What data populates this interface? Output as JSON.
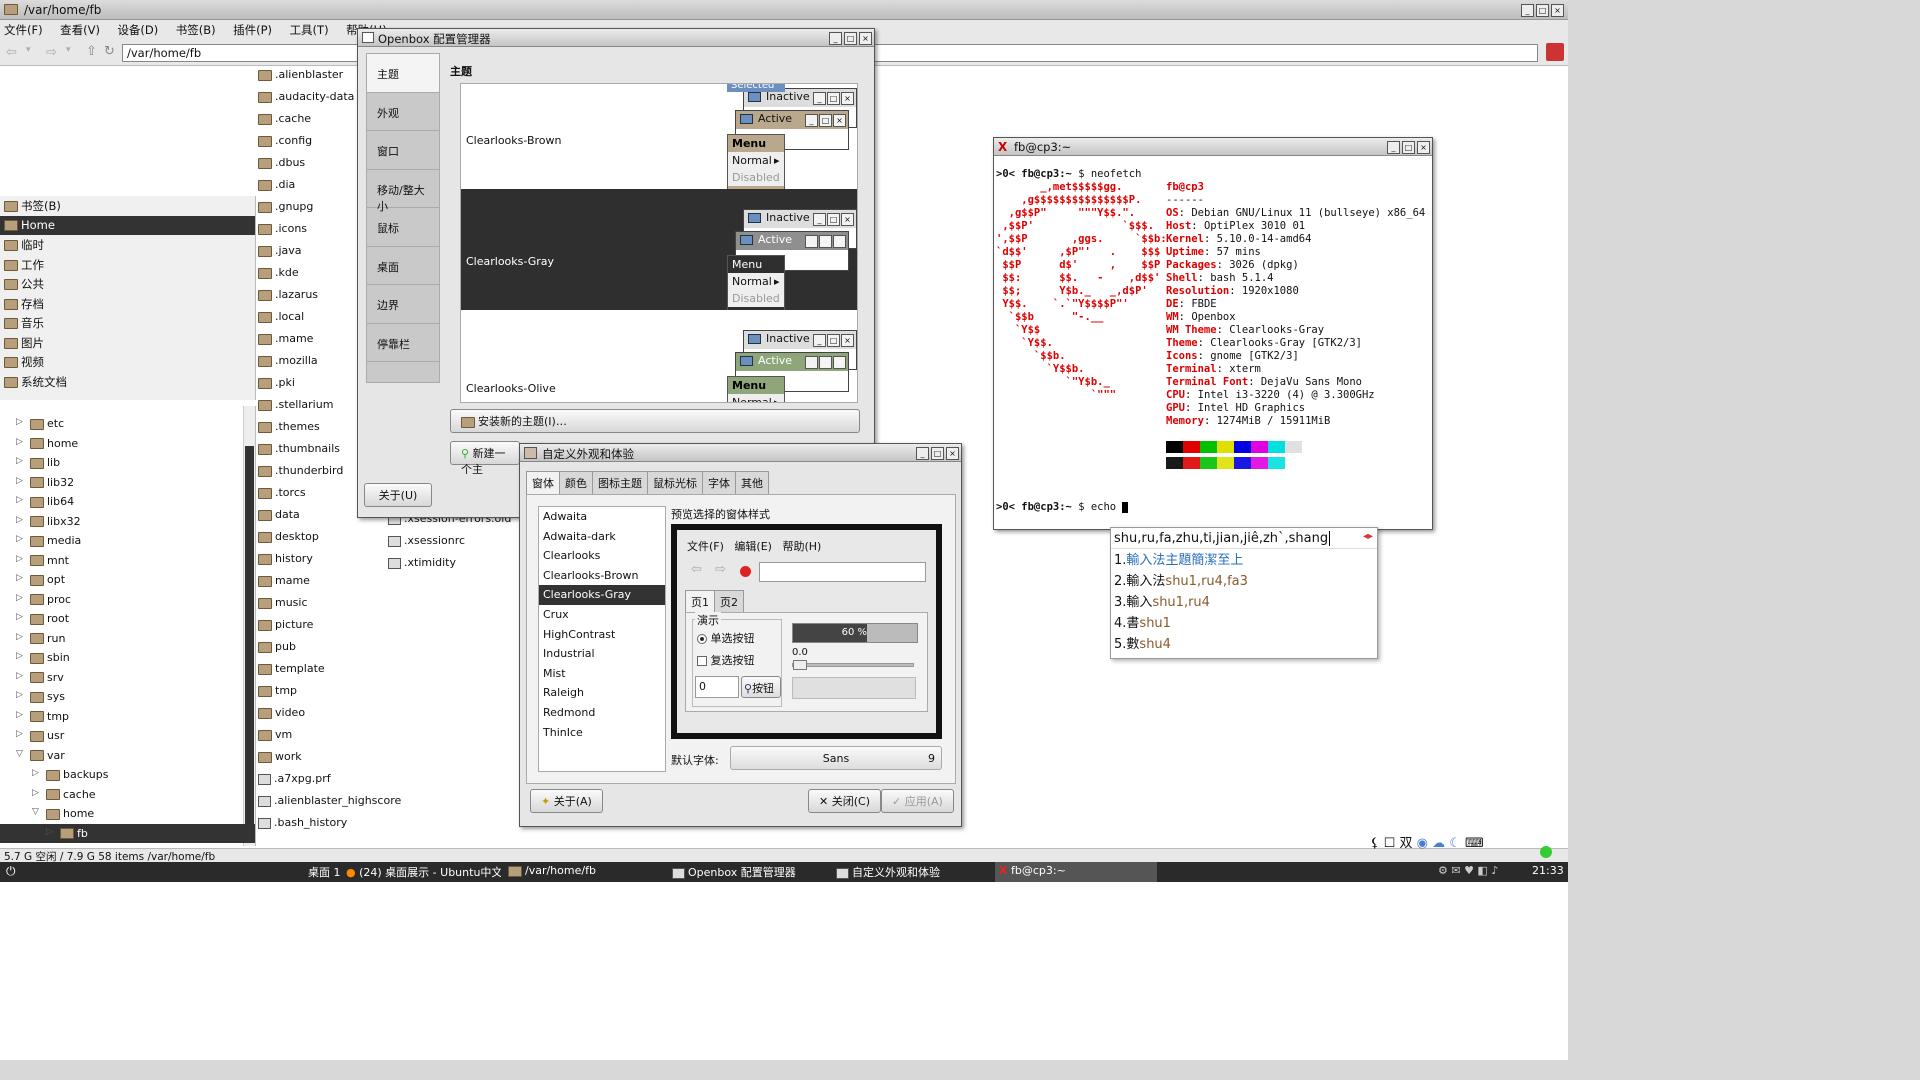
{
  "fm": {
    "title": "/var/home/fb",
    "menu": [
      "文件(F)",
      "查看(V)",
      "设备(D)",
      "书签(B)",
      "插件(P)",
      "工具(T)",
      "帮助(H)"
    ],
    "path": "/var/home/fb",
    "bookmarks": [
      "书签(B)",
      "Home",
      "临时",
      "工作",
      "公共",
      "存档",
      "音乐",
      "图片",
      "视频",
      "系统文档"
    ],
    "tree": [
      {
        "n": "etc",
        "l": 1
      },
      {
        "n": "home",
        "l": 1
      },
      {
        "n": "lib",
        "l": 1
      },
      {
        "n": "lib32",
        "l": 1
      },
      {
        "n": "lib64",
        "l": 1
      },
      {
        "n": "libx32",
        "l": 1
      },
      {
        "n": "media",
        "l": 1
      },
      {
        "n": "mnt",
        "l": 1
      },
      {
        "n": "opt",
        "l": 1
      },
      {
        "n": "proc",
        "l": 1
      },
      {
        "n": "root",
        "l": 1
      },
      {
        "n": "run",
        "l": 1
      },
      {
        "n": "sbin",
        "l": 1
      },
      {
        "n": "srv",
        "l": 1
      },
      {
        "n": "sys",
        "l": 1
      },
      {
        "n": "tmp",
        "l": 1
      },
      {
        "n": "usr",
        "l": 1
      },
      {
        "n": "var",
        "l": 1
      },
      {
        "n": "backups",
        "l": 2
      },
      {
        "n": "cache",
        "l": 2
      },
      {
        "n": "home",
        "l": 2
      },
      {
        "n": "fb",
        "l": 3
      }
    ],
    "files": [
      ".alienblaster",
      ".audacity-data",
      ".cache",
      ".config",
      ".dbus",
      ".dia",
      ".gnupg",
      ".icons",
      ".java",
      ".kde",
      ".lazarus",
      ".local",
      ".mame",
      ".mozilla",
      ".pki",
      ".stellarium",
      ".themes",
      ".thumbnails",
      ".thunderbird",
      ".torcs",
      "data",
      "desktop",
      "history",
      "mame",
      "music",
      "picture",
      "pub",
      "template",
      "tmp",
      "video",
      "vm",
      "work",
      ".a7xpg.prf",
      ".alienblaster_highscore",
      ".bash_history"
    ],
    "files2": [
      ".xsession-errors.old",
      ".xsessionrc",
      ".xtimidity"
    ],
    "status": "5.7 G 空闲 / 7.9 G 58 items  /var/home/fb"
  },
  "ob": {
    "title": "Openbox 配置管理器",
    "tabs": [
      "主题",
      "外观",
      "窗口",
      "移动/整大小",
      "鼠标",
      "桌面",
      "边界",
      "停靠栏"
    ],
    "head": "主题",
    "themes": [
      "Clearlooks-Brown",
      "Clearlooks-Gray",
      "Clearlooks-Olive"
    ],
    "inactive": "Inactive",
    "active": "Active",
    "selected": "Selected",
    "menu": [
      "Menu",
      "Normal",
      "Disabled",
      "Selected"
    ],
    "install": "安装新的主题(I)…",
    "new": "新建一个主",
    "about": "关于(U)"
  },
  "cu": {
    "title": "自定义外观和体验",
    "tabs": [
      "窗体",
      "颜色",
      "图标主题",
      "鼠标光标",
      "字体",
      "其他"
    ],
    "list": [
      "Adwaita",
      "Adwaita-dark",
      "Clearlooks",
      "Clearlooks-Brown",
      "Clearlooks-Gray",
      "Crux",
      "HighContrast",
      "Industrial",
      "Mist",
      "Raleigh",
      "Redmond",
      "ThinIce"
    ],
    "prev_label": "预览选择的窗体样式",
    "prev_menu": [
      "文件(F)",
      "编辑(E)",
      "帮助(H)"
    ],
    "prev_tabs": [
      "页1",
      "页2"
    ],
    "demo": "演示",
    "radio": "单选按钮",
    "check": "复选按钮",
    "spin": "0",
    "button": "按钮",
    "progress": "60 %",
    "scale": "0.0",
    "font_label": "默认字体:",
    "font": "Sans",
    "font_size": "9",
    "about": "关于(A)",
    "close": "关闭(C)",
    "apply": "应用(A)"
  },
  "term": {
    "title": "fb@cp3:~",
    "prompt": ">0< fb@cp3:~",
    "cmd1": "$ neofetch",
    "cmd2": "$ echo ",
    "logo": [
      "       _,met$$$$$gg.",
      "    ,g$$$$$$$$$$$$$$$P.",
      "  ,g$$P\"     \"\"\"Y$$.\".",
      " ,$$P'              `$$$.",
      "',$$P       ,ggs.     `$$b:",
      "`d$$'     ,$P\"'   .    $$$",
      " $$P      d$'     ,    $$P",
      " $$:      $$.   -    ,d$$'",
      " $$;      Y$b._   _,d$P'",
      " Y$$.    `.`\"Y$$$$P\"'",
      "  `$$b      \"-.__",
      "   `Y$$",
      "    `Y$$.",
      "      `$$b.",
      "        `Y$$b.",
      "           `\"Y$b._",
      "               `\"\"\""
    ],
    "user": "fb@cp3",
    "sep": "------",
    "info": [
      [
        "OS",
        "Debian GNU/Linux 11 (bullseye) x86_64"
      ],
      [
        "Host",
        "OptiPlex 3010 01"
      ],
      [
        "Kernel",
        "5.10.0-14-amd64"
      ],
      [
        "Uptime",
        "57 mins"
      ],
      [
        "Packages",
        "3026 (dpkg)"
      ],
      [
        "Shell",
        "bash 5.1.4"
      ],
      [
        "Resolution",
        "1920x1080"
      ],
      [
        "DE",
        "FBDE"
      ],
      [
        "WM",
        "Openbox"
      ],
      [
        "WM Theme",
        "Clearlooks-Gray"
      ],
      [
        "Theme",
        "Clearlooks-Gray [GTK2/3]"
      ],
      [
        "Icons",
        "gnome [GTK2/3]"
      ],
      [
        "Terminal",
        "xterm"
      ],
      [
        "Terminal Font",
        "DejaVu Sans Mono"
      ],
      [
        "CPU",
        "Intel i3-3220 (4) @ 3.300GHz"
      ],
      [
        "GPU",
        "Intel HD Graphics"
      ],
      [
        "Memory",
        "1274MiB / 15911MiB"
      ]
    ],
    "colors": [
      "#000000",
      "#e00000",
      "#00c000",
      "#e0e000",
      "#0000e0",
      "#e000e0",
      "#00e0e0",
      "#e0e0e0"
    ]
  },
  "ime": {
    "input": "shu,ru,fa,zhu,ti,jian,jiê,zh`,shang",
    "c1": "輸入法主題簡潔至上",
    "c2a": "輸入法",
    "c2b": "shu1,ru4,fa3",
    "c3a": "輸入",
    "c3b": "shu1,ru4",
    "c4a": "書",
    "c4b": "shu1",
    "c5a": "數",
    "c5b": "shu4"
  },
  "task": {
    "desk": "桌面 1",
    "items": [
      "(24) 桌面展示 - Ubuntu中文…",
      "/var/home/fb",
      "Openbox 配置管理器",
      "自定义外观和体验",
      "fb@cp3:~"
    ],
    "time": "21:33"
  },
  "tray": [
    "双"
  ]
}
